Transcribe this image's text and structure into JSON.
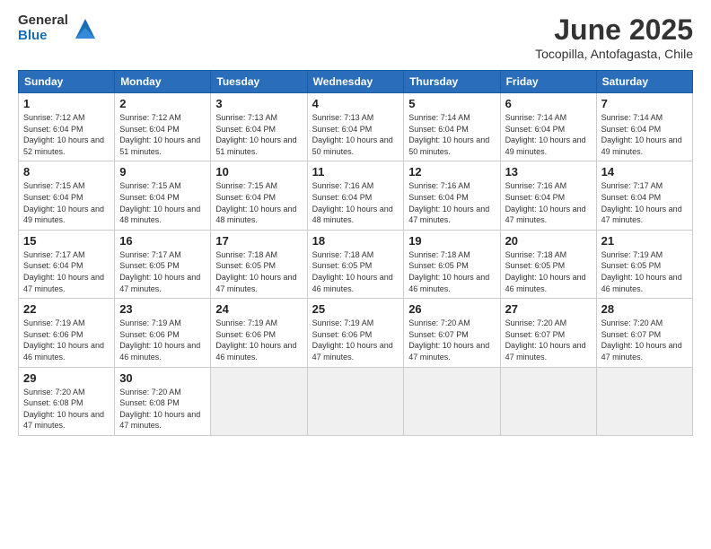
{
  "logo": {
    "general": "General",
    "blue": "Blue"
  },
  "title": "June 2025",
  "subtitle": "Tocopilla, Antofagasta, Chile",
  "headers": [
    "Sunday",
    "Monday",
    "Tuesday",
    "Wednesday",
    "Thursday",
    "Friday",
    "Saturday"
  ],
  "weeks": [
    [
      {
        "day": "1",
        "sunrise": "Sunrise: 7:12 AM",
        "sunset": "Sunset: 6:04 PM",
        "daylight": "Daylight: 10 hours and 52 minutes."
      },
      {
        "day": "2",
        "sunrise": "Sunrise: 7:12 AM",
        "sunset": "Sunset: 6:04 PM",
        "daylight": "Daylight: 10 hours and 51 minutes."
      },
      {
        "day": "3",
        "sunrise": "Sunrise: 7:13 AM",
        "sunset": "Sunset: 6:04 PM",
        "daylight": "Daylight: 10 hours and 51 minutes."
      },
      {
        "day": "4",
        "sunrise": "Sunrise: 7:13 AM",
        "sunset": "Sunset: 6:04 PM",
        "daylight": "Daylight: 10 hours and 50 minutes."
      },
      {
        "day": "5",
        "sunrise": "Sunrise: 7:14 AM",
        "sunset": "Sunset: 6:04 PM",
        "daylight": "Daylight: 10 hours and 50 minutes."
      },
      {
        "day": "6",
        "sunrise": "Sunrise: 7:14 AM",
        "sunset": "Sunset: 6:04 PM",
        "daylight": "Daylight: 10 hours and 49 minutes."
      },
      {
        "day": "7",
        "sunrise": "Sunrise: 7:14 AM",
        "sunset": "Sunset: 6:04 PM",
        "daylight": "Daylight: 10 hours and 49 minutes."
      }
    ],
    [
      {
        "day": "8",
        "sunrise": "Sunrise: 7:15 AM",
        "sunset": "Sunset: 6:04 PM",
        "daylight": "Daylight: 10 hours and 49 minutes."
      },
      {
        "day": "9",
        "sunrise": "Sunrise: 7:15 AM",
        "sunset": "Sunset: 6:04 PM",
        "daylight": "Daylight: 10 hours and 48 minutes."
      },
      {
        "day": "10",
        "sunrise": "Sunrise: 7:15 AM",
        "sunset": "Sunset: 6:04 PM",
        "daylight": "Daylight: 10 hours and 48 minutes."
      },
      {
        "day": "11",
        "sunrise": "Sunrise: 7:16 AM",
        "sunset": "Sunset: 6:04 PM",
        "daylight": "Daylight: 10 hours and 48 minutes."
      },
      {
        "day": "12",
        "sunrise": "Sunrise: 7:16 AM",
        "sunset": "Sunset: 6:04 PM",
        "daylight": "Daylight: 10 hours and 47 minutes."
      },
      {
        "day": "13",
        "sunrise": "Sunrise: 7:16 AM",
        "sunset": "Sunset: 6:04 PM",
        "daylight": "Daylight: 10 hours and 47 minutes."
      },
      {
        "day": "14",
        "sunrise": "Sunrise: 7:17 AM",
        "sunset": "Sunset: 6:04 PM",
        "daylight": "Daylight: 10 hours and 47 minutes."
      }
    ],
    [
      {
        "day": "15",
        "sunrise": "Sunrise: 7:17 AM",
        "sunset": "Sunset: 6:04 PM",
        "daylight": "Daylight: 10 hours and 47 minutes."
      },
      {
        "day": "16",
        "sunrise": "Sunrise: 7:17 AM",
        "sunset": "Sunset: 6:05 PM",
        "daylight": "Daylight: 10 hours and 47 minutes."
      },
      {
        "day": "17",
        "sunrise": "Sunrise: 7:18 AM",
        "sunset": "Sunset: 6:05 PM",
        "daylight": "Daylight: 10 hours and 47 minutes."
      },
      {
        "day": "18",
        "sunrise": "Sunrise: 7:18 AM",
        "sunset": "Sunset: 6:05 PM",
        "daylight": "Daylight: 10 hours and 46 minutes."
      },
      {
        "day": "19",
        "sunrise": "Sunrise: 7:18 AM",
        "sunset": "Sunset: 6:05 PM",
        "daylight": "Daylight: 10 hours and 46 minutes."
      },
      {
        "day": "20",
        "sunrise": "Sunrise: 7:18 AM",
        "sunset": "Sunset: 6:05 PM",
        "daylight": "Daylight: 10 hours and 46 minutes."
      },
      {
        "day": "21",
        "sunrise": "Sunrise: 7:19 AM",
        "sunset": "Sunset: 6:05 PM",
        "daylight": "Daylight: 10 hours and 46 minutes."
      }
    ],
    [
      {
        "day": "22",
        "sunrise": "Sunrise: 7:19 AM",
        "sunset": "Sunset: 6:06 PM",
        "daylight": "Daylight: 10 hours and 46 minutes."
      },
      {
        "day": "23",
        "sunrise": "Sunrise: 7:19 AM",
        "sunset": "Sunset: 6:06 PM",
        "daylight": "Daylight: 10 hours and 46 minutes."
      },
      {
        "day": "24",
        "sunrise": "Sunrise: 7:19 AM",
        "sunset": "Sunset: 6:06 PM",
        "daylight": "Daylight: 10 hours and 46 minutes."
      },
      {
        "day": "25",
        "sunrise": "Sunrise: 7:19 AM",
        "sunset": "Sunset: 6:06 PM",
        "daylight": "Daylight: 10 hours and 47 minutes."
      },
      {
        "day": "26",
        "sunrise": "Sunrise: 7:20 AM",
        "sunset": "Sunset: 6:07 PM",
        "daylight": "Daylight: 10 hours and 47 minutes."
      },
      {
        "day": "27",
        "sunrise": "Sunrise: 7:20 AM",
        "sunset": "Sunset: 6:07 PM",
        "daylight": "Daylight: 10 hours and 47 minutes."
      },
      {
        "day": "28",
        "sunrise": "Sunrise: 7:20 AM",
        "sunset": "Sunset: 6:07 PM",
        "daylight": "Daylight: 10 hours and 47 minutes."
      }
    ],
    [
      {
        "day": "29",
        "sunrise": "Sunrise: 7:20 AM",
        "sunset": "Sunset: 6:08 PM",
        "daylight": "Daylight: 10 hours and 47 minutes."
      },
      {
        "day": "30",
        "sunrise": "Sunrise: 7:20 AM",
        "sunset": "Sunset: 6:08 PM",
        "daylight": "Daylight: 10 hours and 47 minutes."
      },
      null,
      null,
      null,
      null,
      null
    ]
  ]
}
